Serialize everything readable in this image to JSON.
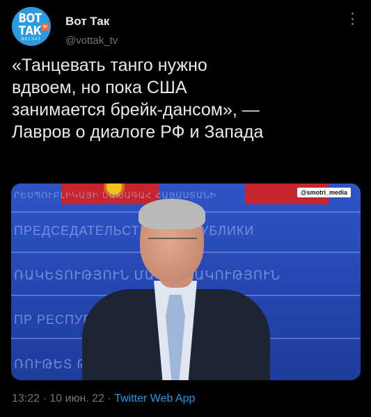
{
  "author": {
    "name": "Вот Так",
    "handle": "@vottak_tv",
    "avatar": {
      "line1": "ВОТ",
      "line2": "ТАК",
      "badge": "tv",
      "line3": "BELSAT",
      "bg": "#2b9ae0"
    }
  },
  "tweet": {
    "text": "«Танцевать танго нужно\nвдвоем, но пока США\nзанимается брейк-дансом», —\nЛавров о диалоге РФ и Запада"
  },
  "media": {
    "watermark": "@smotri_media",
    "wall_text": [
      "ՐԵՍՊՈՒԲԼԻԿԱՅԻ ՆԱԽԱԳԱՀ ՀԱՅԱՍՏԱՆԻ",
      "ПРЕДСЕДАТЕЛЬСТВО РЕСПУБЛИКИ",
      "ՌԱԿԵՏՈՒԹՅՈՒՆ ՄԱԿԱՐԴԱԿՈՒԹՅՈՒՆ",
      "ПР                         РЕСПУБЛИКИ",
      "ՌՈՒԹԵՏ                      ԹՅՈՒՆ"
    ]
  },
  "meta": {
    "time": "13:22",
    "separator1": " · ",
    "date": "10 июн. 22",
    "separator2": " · ",
    "source": "Twitter Web App"
  },
  "colors": {
    "background": "#000000",
    "text": "#e7e9ea",
    "muted": "#71767b",
    "link": "#1d9bf0"
  },
  "icons": {
    "more": "more-vertical-icon"
  }
}
